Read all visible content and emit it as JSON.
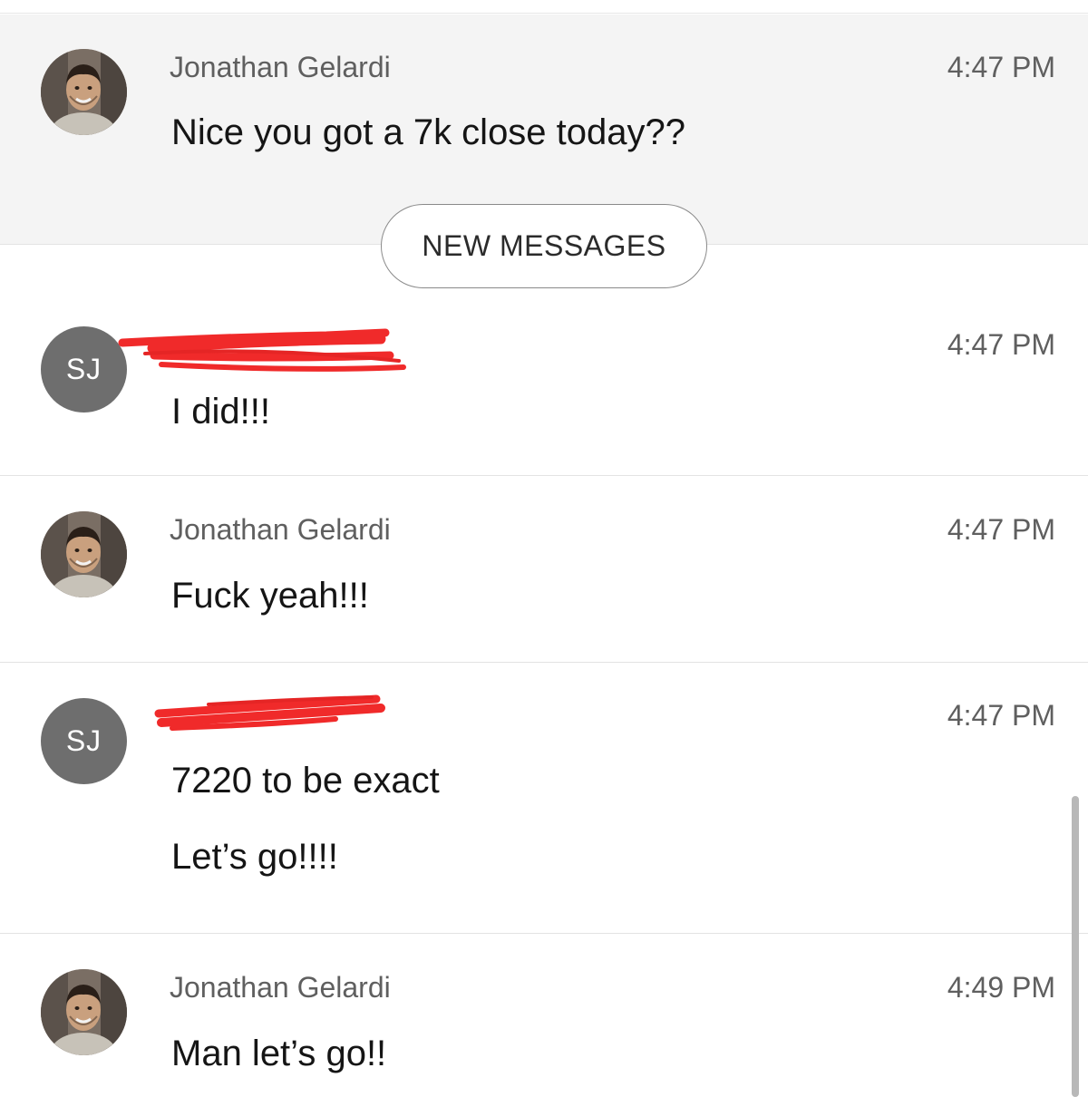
{
  "new_messages_label": "NEW MESSAGES",
  "messages": [
    {
      "sender": "Jonathan Gelardi",
      "avatar": "profile-photo",
      "time": "4:47 PM",
      "lines": [
        "Nice you got a 7k close today??"
      ]
    },
    {
      "sender": "",
      "sender_redacted": true,
      "avatar_initials": "SJ",
      "time": "4:47 PM",
      "lines": [
        "I did!!!"
      ]
    },
    {
      "sender": "Jonathan Gelardi",
      "avatar": "profile-photo",
      "time": "4:47 PM",
      "lines": [
        "Fuck yeah!!!"
      ]
    },
    {
      "sender": "",
      "sender_redacted": true,
      "avatar_initials": "SJ",
      "time": "4:47 PM",
      "lines": [
        "7220 to be exact",
        "Let’s go!!!!"
      ]
    },
    {
      "sender": "Jonathan Gelardi",
      "avatar": "profile-photo",
      "time": "4:49 PM",
      "lines": [
        "Man let’s go!!"
      ]
    }
  ],
  "colors": {
    "highlight_bg": "#f4f4f4",
    "initials_avatar": "#6e6e6e",
    "redaction": "#f02a2a"
  }
}
